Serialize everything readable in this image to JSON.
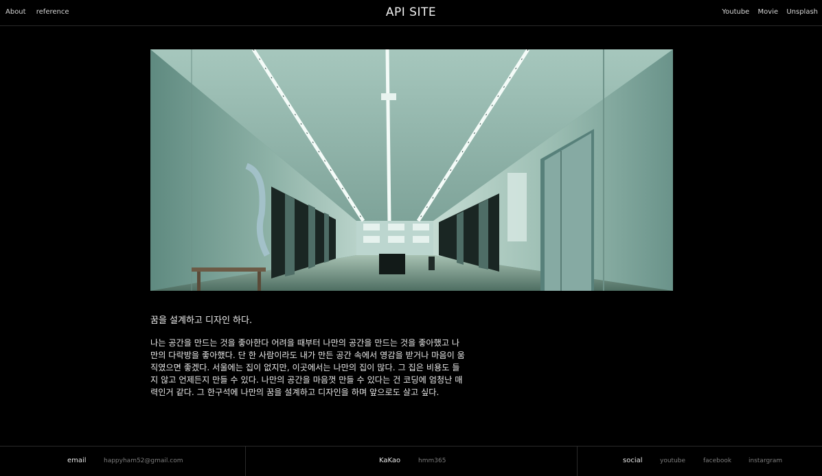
{
  "header": {
    "nav_left": [
      "About",
      "reference"
    ],
    "title": "API SITE",
    "nav_right": [
      "Youtube",
      "Movie",
      "Unsplash"
    ]
  },
  "content": {
    "heading": "꿈을 설계하고 디자인 하다.",
    "body": "나는 공간을 만드는 것을 좋아한다 어려을 때부터 나만의 공간을 만드는 것을 좋아했고 나만의 다락방을 좋아했다. 단 한 사람이라도 내가 만든 공간 속에서 영감을 받거나 마음이 움직였으면 좋겠다. 서울에는 집이 없지만, 이곳에서는 나만의 집이 많다. 그 집은 비용도 들지 않고 언제든지 만들 수 있다. 나만의 공간을 마음껏 만들 수 있다는 건 코딩에 엄청난 매력인거 같다. 그 한구석에 나만의 꿈을 설계하고 디자인을 하며 앞으로도 살고 싶다."
  },
  "footer": {
    "email_label": "email",
    "email_value": "happyham52@gmail.com",
    "kakao_label": "KaKao",
    "kakao_value": "hmm365",
    "social_label": "social",
    "social_links": [
      "youtube",
      "facebook",
      "instargram"
    ]
  }
}
